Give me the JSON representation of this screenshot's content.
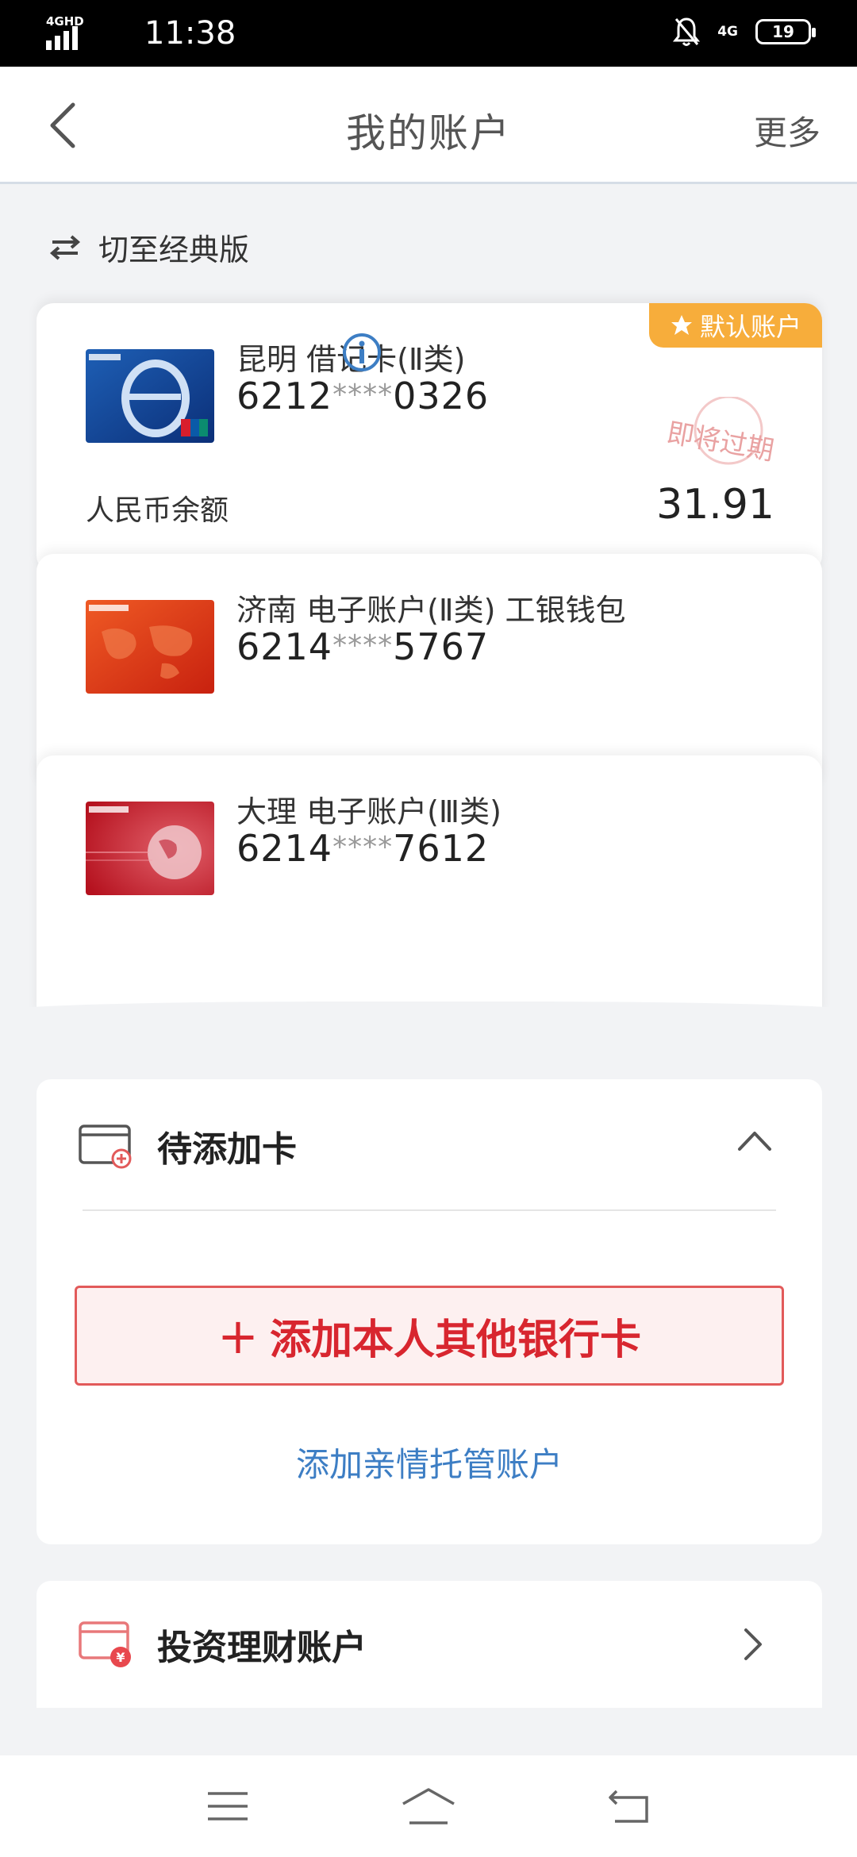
{
  "status_bar": {
    "network": "4GHD",
    "time": "11:38",
    "mobile": "4G",
    "battery": "19"
  },
  "header": {
    "title": "我的账户",
    "more_label": "更多"
  },
  "switch": {
    "label": "切至经典版"
  },
  "accounts": [
    {
      "name": "昆明 借记卡(Ⅱ类)",
      "num_prefix": "6212",
      "num_mask": "****",
      "num_suffix": "0326",
      "badge": "默认账户",
      "stamp": "即将过期",
      "balance_label": "人民币余额",
      "balance": "31.91"
    },
    {
      "name": "济南 电子账户(Ⅱ类) 工银钱包",
      "num_prefix": "6214",
      "num_mask": "****",
      "num_suffix": "5767"
    },
    {
      "name": "大理 电子账户(Ⅲ类)",
      "num_prefix": "6214",
      "num_mask": "****",
      "num_suffix": "7612"
    }
  ],
  "pending": {
    "title": "待添加卡",
    "add_button_plus": "+",
    "add_button": "添加本人其他银行卡",
    "family_link": "添加亲情托管账户"
  },
  "investment": {
    "title": "投资理财账户"
  },
  "colors": {
    "accent_red": "#d8262f",
    "link_blue": "#3d7ec4",
    "badge_orange": "#f7ad3b"
  }
}
